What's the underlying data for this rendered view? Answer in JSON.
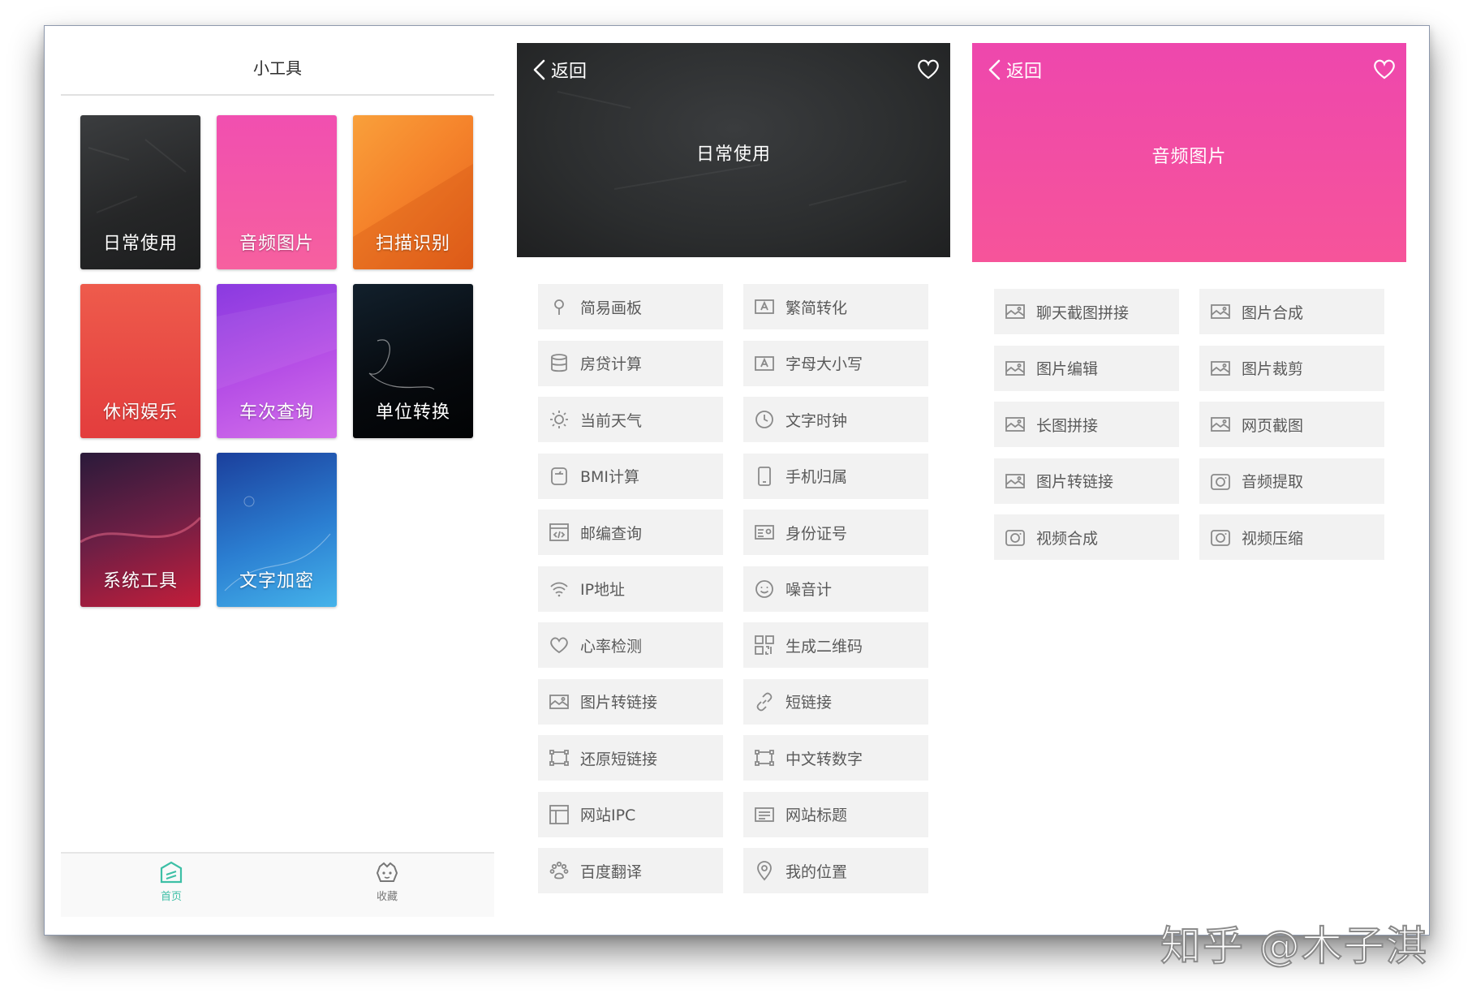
{
  "panel_home": {
    "title": "小工具",
    "tiles": [
      {
        "label": "日常使用"
      },
      {
        "label": "音频图片"
      },
      {
        "label": "扫描识别"
      },
      {
        "label": "休闲娱乐"
      },
      {
        "label": "车次查询"
      },
      {
        "label": "单位转换"
      },
      {
        "label": "系统工具"
      },
      {
        "label": "文字加密"
      }
    ],
    "tabs": [
      {
        "label": "首页",
        "active": true
      },
      {
        "label": "收藏",
        "active": false
      }
    ]
  },
  "panel_daily": {
    "back_label": "返回",
    "title": "日常使用",
    "items": [
      {
        "label": "简易画板",
        "icon": "pin-icon"
      },
      {
        "label": "繁简转化",
        "icon": "letter-a-icon"
      },
      {
        "label": "房贷计算",
        "icon": "database-icon"
      },
      {
        "label": "字母大小写",
        "icon": "letter-a-icon"
      },
      {
        "label": "当前天气",
        "icon": "sun-icon"
      },
      {
        "label": "文字时钟",
        "icon": "clock-icon"
      },
      {
        "label": "BMI计算",
        "icon": "scale-icon"
      },
      {
        "label": "手机归属",
        "icon": "phone-icon"
      },
      {
        "label": "邮编查询",
        "icon": "code-icon"
      },
      {
        "label": "身份证号",
        "icon": "id-card-icon"
      },
      {
        "label": "IP地址",
        "icon": "wifi-icon"
      },
      {
        "label": "噪音计",
        "icon": "smile-icon"
      },
      {
        "label": "心率检测",
        "icon": "heart-icon"
      },
      {
        "label": "生成二维码",
        "icon": "qrcode-icon"
      },
      {
        "label": "图片转链接",
        "icon": "image-icon"
      },
      {
        "label": "短链接",
        "icon": "link-icon"
      },
      {
        "label": "还原短链接",
        "icon": "expand-icon"
      },
      {
        "label": "中文转数字",
        "icon": "expand-icon"
      },
      {
        "label": "网站IPC",
        "icon": "layout-icon"
      },
      {
        "label": "网站标题",
        "icon": "title-icon"
      },
      {
        "label": "百度翻译",
        "icon": "paw-icon"
      },
      {
        "label": "我的位置",
        "icon": "location-icon"
      }
    ]
  },
  "panel_media": {
    "back_label": "返回",
    "title": "音频图片",
    "items": [
      {
        "label": "聊天截图拼接",
        "icon": "image-icon"
      },
      {
        "label": "图片合成",
        "icon": "image-icon"
      },
      {
        "label": "图片编辑",
        "icon": "image-icon"
      },
      {
        "label": "图片裁剪",
        "icon": "image-icon"
      },
      {
        "label": "长图拼接",
        "icon": "image-icon"
      },
      {
        "label": "网页截图",
        "icon": "image-icon"
      },
      {
        "label": "图片转链接",
        "icon": "image-icon"
      },
      {
        "label": "音频提取",
        "icon": "camera-icon"
      },
      {
        "label": "视频合成",
        "icon": "camera-icon"
      },
      {
        "label": "视频压缩",
        "icon": "camera-icon"
      }
    ]
  },
  "watermark": "知乎 @木子淇",
  "colors": {
    "accent_teal": "#3dbfa6",
    "pink": "#f2479d",
    "chalkboard": "#2b2d2e",
    "item_bg": "#f2f2f2"
  }
}
